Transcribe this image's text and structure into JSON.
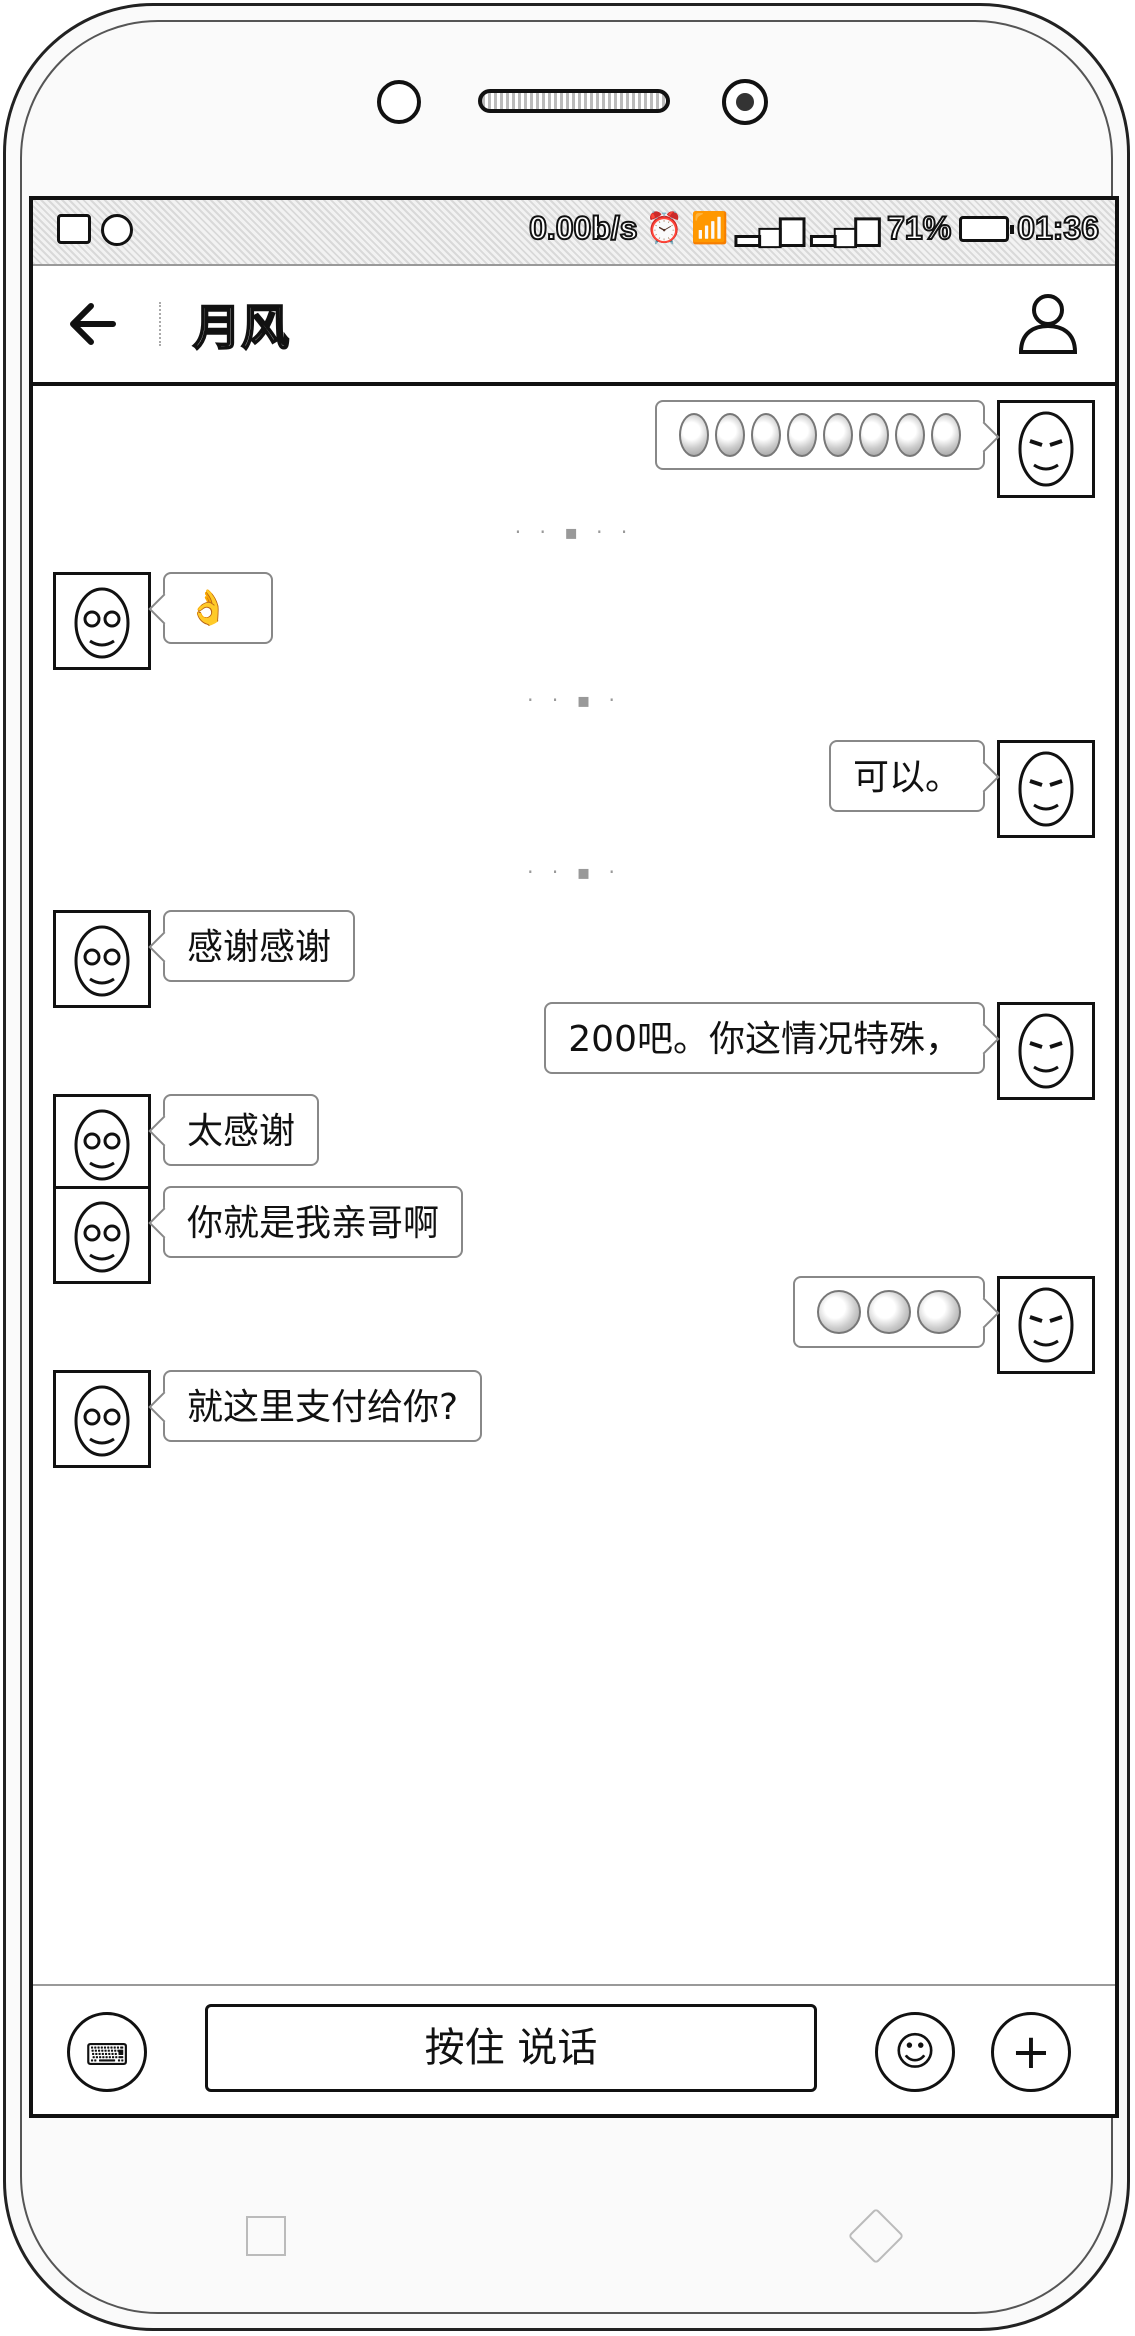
{
  "status_bar": {
    "speed": "0.00b/s",
    "battery": "71%",
    "time": "01:36"
  },
  "header": {
    "title": "月风"
  },
  "messages": [
    {
      "side": "right",
      "type": "emoji",
      "count": 8
    },
    {
      "side": "left",
      "type": "emoji-single"
    },
    {
      "side": "right",
      "text": "可以。"
    },
    {
      "side": "left",
      "text": "感谢感谢"
    },
    {
      "side": "right",
      "text": "200吧。你这情况特殊，"
    },
    {
      "side": "left",
      "text": "太感谢"
    },
    {
      "side": "left",
      "text": "你就是我亲哥啊"
    },
    {
      "side": "right",
      "type": "emoji",
      "count": 3
    },
    {
      "side": "left",
      "text": "就这里支付给你?"
    }
  ],
  "input_bar": {
    "voice_label": "按住 说话"
  },
  "icons": {
    "back": "arrow-left-icon",
    "profile": "person-icon",
    "keyboard": "keyboard-icon",
    "emoji": "smiley-icon",
    "plus": "plus-icon"
  }
}
